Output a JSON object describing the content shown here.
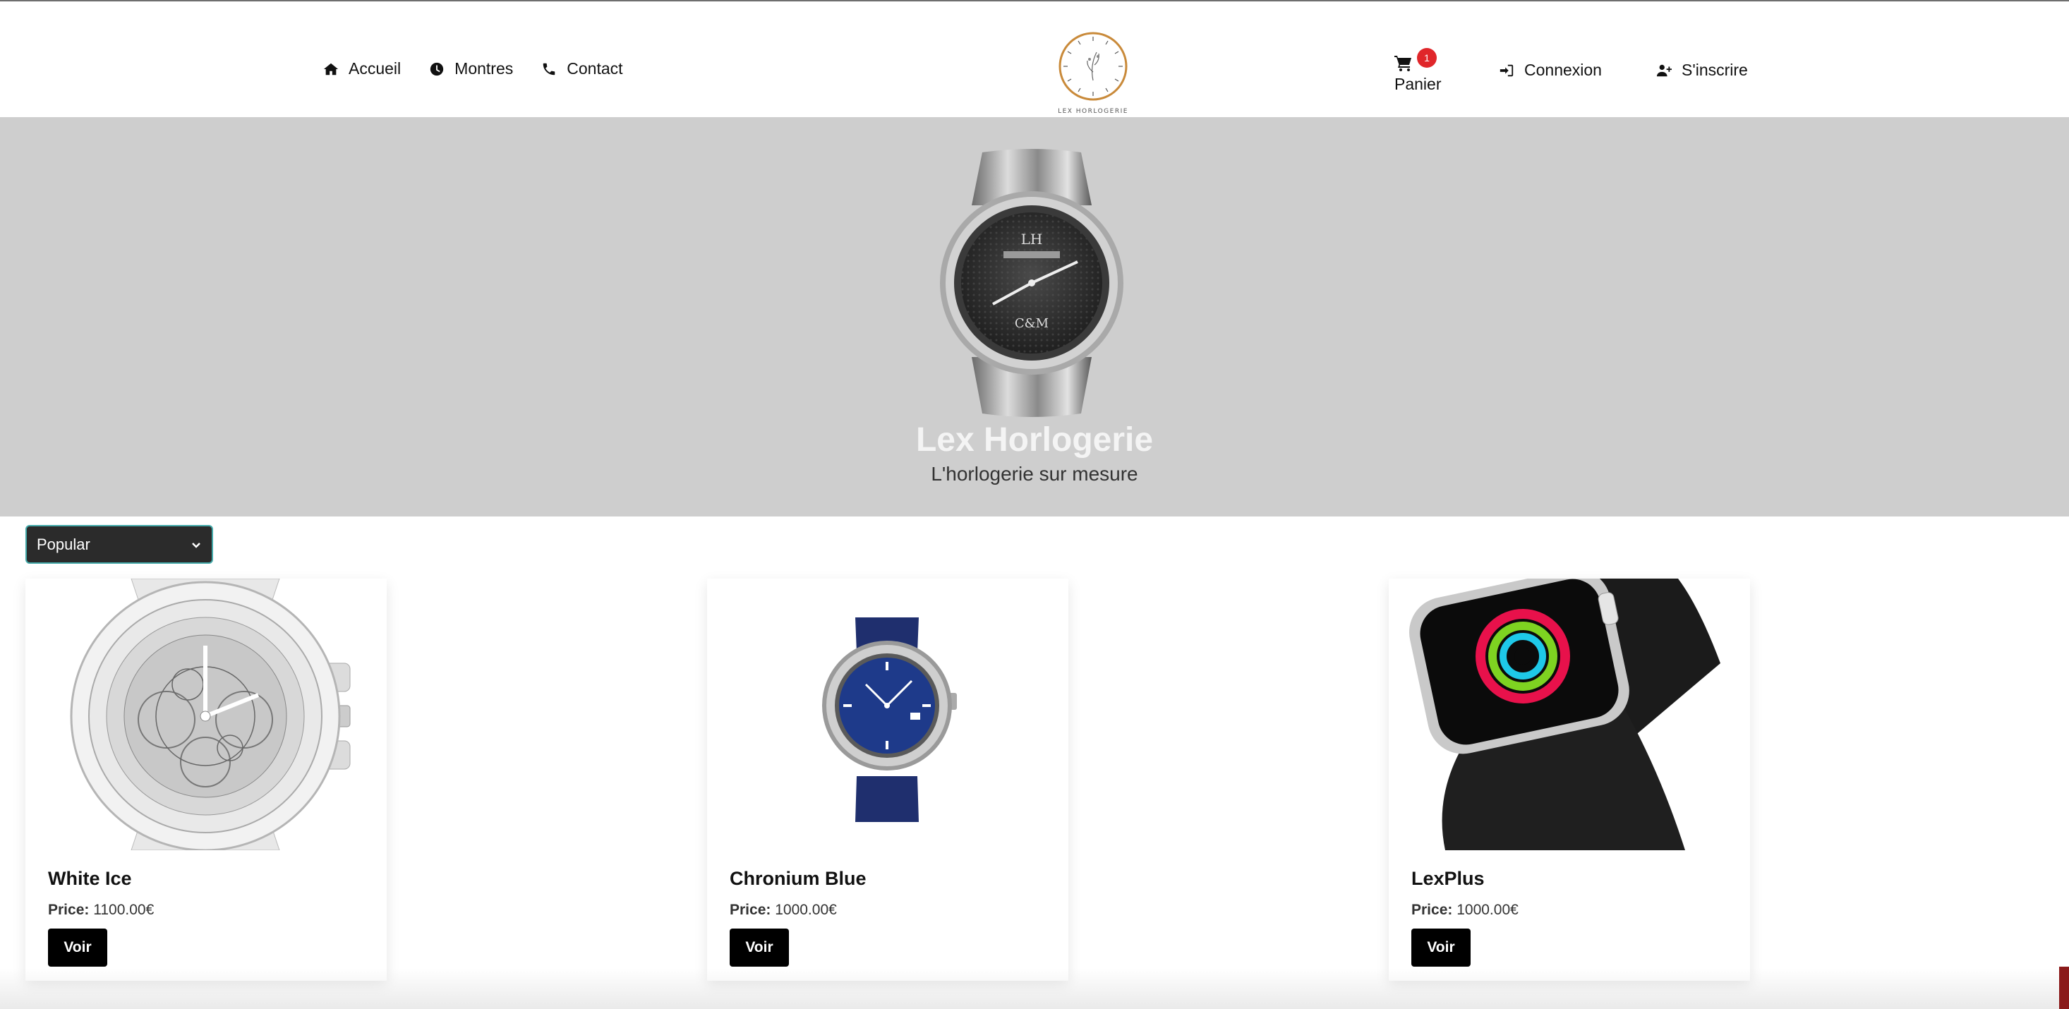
{
  "nav": {
    "items": [
      {
        "label": "Accueil",
        "icon": "home-icon"
      },
      {
        "label": "Montres",
        "icon": "clock-icon"
      },
      {
        "label": "Contact",
        "icon": "phone-icon"
      }
    ],
    "cart": {
      "label": "Panier",
      "count": "1"
    },
    "login": {
      "label": "Connexion",
      "icon": "sign-in-icon"
    },
    "register": {
      "label": "S'inscrire",
      "icon": "user-plus-icon"
    },
    "logo_text": "LEX HORLOGERIE"
  },
  "hero": {
    "title": "Lex Horlogerie",
    "subtitle": "L'horlogerie sur mesure",
    "watch_initials": "LH",
    "watch_logo": "C&M"
  },
  "sort": {
    "selected": "Popular"
  },
  "products": [
    {
      "name": "White Ice",
      "price_label": "Price:",
      "price": "1100.00€",
      "button": "Voir"
    },
    {
      "name": "Chronium Blue",
      "price_label": "Price:",
      "price": "1000.00€",
      "button": "Voir"
    },
    {
      "name": "LexPlus",
      "price_label": "Price:",
      "price": "1000.00€",
      "button": "Voir"
    }
  ],
  "colors": {
    "badge": "#e0262a",
    "hero_bg": "#cecece",
    "button": "#000000",
    "logo_ring": "#c98a3a"
  }
}
